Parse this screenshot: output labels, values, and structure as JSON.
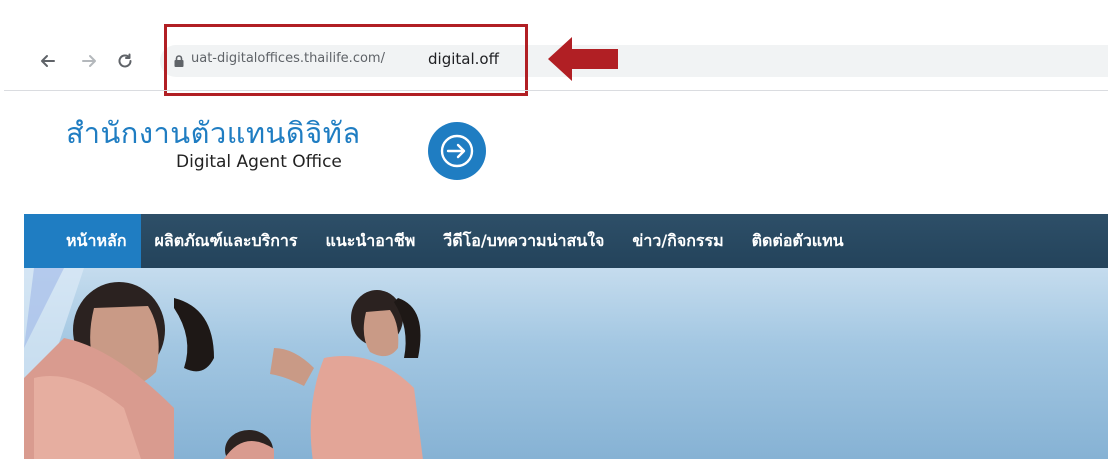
{
  "browser": {
    "url_domain": "uat-digitaloffices.thailife.com/",
    "url_path": "digital.off",
    "icons": [
      "back-arrow-icon",
      "forward-arrow-icon",
      "reload-icon",
      "lock-icon"
    ],
    "annotation_color": "#b11f24"
  },
  "site": {
    "brand_th": "สำนักงานตัวแทนดิจิทัล",
    "brand_en": "Digital Agent Office",
    "brand_color": "#1f7dc2",
    "login_icon": "sign-in-icon"
  },
  "nav": {
    "items": [
      {
        "label": "หน้าหลัก",
        "active": true
      },
      {
        "label": "ผลิตภัณฑ์และบริการ",
        "active": false
      },
      {
        "label": "แนะนำอาชีพ",
        "active": false
      },
      {
        "label": "วีดีโอ/บทความน่าสนใจ",
        "active": false
      },
      {
        "label": "ข่าว/กิจกรรม",
        "active": false
      },
      {
        "label": "ติดต่อตัวแทน",
        "active": false
      }
    ]
  }
}
